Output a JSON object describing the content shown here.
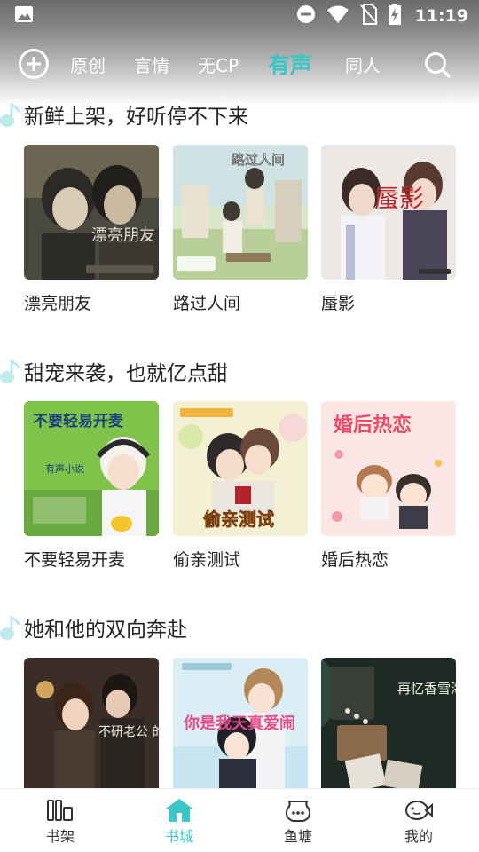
{
  "status_bar": {
    "time": "11:19",
    "icons": [
      "image-icon",
      "do-not-disturb-icon",
      "wifi-icon",
      "no-sim-icon",
      "battery-charging-icon"
    ]
  },
  "nav": {
    "tabs": [
      {
        "label": "原创",
        "active": false
      },
      {
        "label": "言情",
        "active": false
      },
      {
        "label": "无CP",
        "active": false
      },
      {
        "label": "有声",
        "active": true
      },
      {
        "label": "同人",
        "active": false
      }
    ],
    "accent_color": "#3cc6c8"
  },
  "sections": [
    {
      "title": "新鲜上架，好听停不下来",
      "items": [
        {
          "title": "漂亮朋友",
          "cover_text": "漂亮朋友"
        },
        {
          "title": "路过人间",
          "cover_text": "路过人间"
        },
        {
          "title": "蜃影",
          "cover_text": "蜃影"
        }
      ]
    },
    {
      "title": "甜宠来袭，也就亿点甜",
      "items": [
        {
          "title": "不要轻易开麦",
          "cover_text": "不要轻易开麦",
          "cover_subtext": "有声小说"
        },
        {
          "title": "偷亲测试",
          "cover_text": "偷亲测试"
        },
        {
          "title": "婚后热恋",
          "cover_text": "婚后热恋"
        }
      ]
    },
    {
      "title": "她和他的双向奔赴",
      "items": [
        {
          "title": "",
          "cover_text": "不研老公 的一百个理由"
        },
        {
          "title": "",
          "cover_text": "你是我天真爱闹"
        },
        {
          "title": "",
          "cover_text": "再忆香雪海"
        }
      ]
    }
  ],
  "bottom_nav": [
    {
      "label": "书架",
      "icon": "bookshelf-icon",
      "active": false
    },
    {
      "label": "书城",
      "icon": "bookstore-icon",
      "active": true
    },
    {
      "label": "鱼塘",
      "icon": "fishpond-icon",
      "active": false
    },
    {
      "label": "我的",
      "icon": "profile-icon",
      "active": false
    }
  ]
}
